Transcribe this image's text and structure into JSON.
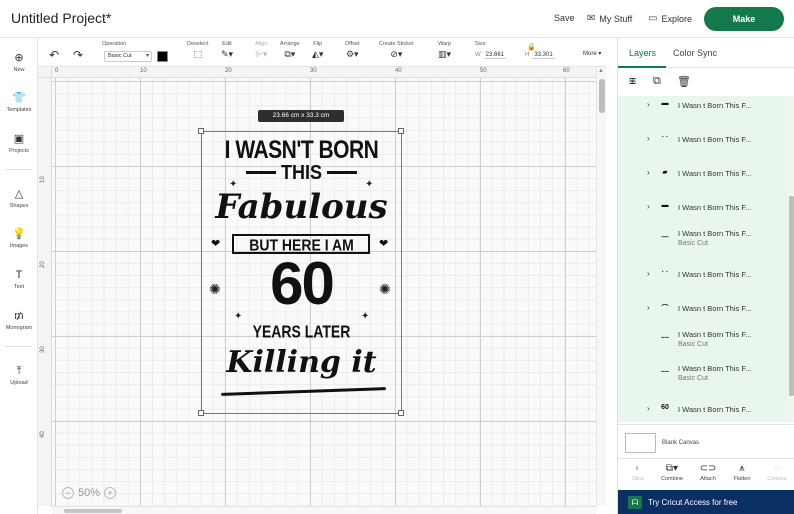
{
  "app": {
    "title": "Untitled Project*",
    "save_label": "Save",
    "mystuff_label": "My Stuff",
    "explore_label": "Explore",
    "make_label": "Make"
  },
  "sidebar": {
    "items": [
      {
        "label": "New",
        "icon": "plus-icon"
      },
      {
        "label": "Templates",
        "icon": "shirt-icon"
      },
      {
        "label": "Projects",
        "icon": "projects-icon"
      },
      {
        "label": "Shapes",
        "icon": "shapes-icon"
      },
      {
        "label": "Images",
        "icon": "lightbulb-icon"
      },
      {
        "label": "Text",
        "icon": "text-icon"
      },
      {
        "label": "Monogram",
        "icon": "monogram-icon"
      },
      {
        "label": "Upload",
        "icon": "upload-icon"
      }
    ]
  },
  "toolbar": {
    "operation_label": "Operation",
    "operation_value": "Basic Cut",
    "deselect_label": "Deselect",
    "edit_label": "Edit",
    "align_label": "Align",
    "arrange_label": "Arrange",
    "flip_label": "Flip",
    "offset_label": "Offset",
    "create_sticker_label": "Create Sticker",
    "warp_label": "Warp",
    "size_label": "Size",
    "width_key": "W",
    "width_value": "23.661",
    "height_key": "H",
    "height_value": "33.301",
    "more_label": "More"
  },
  "canvas": {
    "ruler_top": [
      "0",
      "10",
      "20",
      "30",
      "40",
      "50",
      "60"
    ],
    "ruler_left": [
      "10",
      "20",
      "30",
      "40"
    ],
    "size_tooltip": "23.66  cm x 33.3  cm",
    "zoom_level": "50%",
    "design_lines": [
      "I WASN'T BORN",
      "THIS",
      "Fabulous",
      "BUT HERE I AM",
      "60",
      "YEARS LATER",
      "Killing it"
    ]
  },
  "right_panel": {
    "tabs": [
      "Layers",
      "Color Sync"
    ],
    "layers": [
      {
        "name": "I Wasn t Born This F...",
        "sub": "",
        "thumb": "▬",
        "expandable": true
      },
      {
        "name": "I Wasn t Born This F...",
        "sub": "",
        "thumb": "· ·",
        "expandable": true
      },
      {
        "name": "I Wasn t Born This F...",
        "sub": "",
        "thumb": "▰",
        "expandable": true
      },
      {
        "name": "I Wasn t Born This F...",
        "sub": "",
        "thumb": "▬",
        "expandable": true
      },
      {
        "name": "I Wasn t Born This F...",
        "sub": "Basic Cut",
        "thumb": "—",
        "expandable": false
      },
      {
        "name": "I Wasn t Born This F...",
        "sub": "",
        "thumb": "· ·",
        "expandable": true
      },
      {
        "name": "I Wasn t Born This F...",
        "sub": "",
        "thumb": "⌒",
        "expandable": true
      },
      {
        "name": "I Wasn t Born This F...",
        "sub": "Basic Cut",
        "thumb": "~~",
        "expandable": false
      },
      {
        "name": "I Wasn t Born This F...",
        "sub": "Basic Cut",
        "thumb": "~~",
        "expandable": false
      },
      {
        "name": "I Wasn t Born This F...",
        "sub": "",
        "thumb": "60",
        "expandable": true
      }
    ],
    "blank_canvas_label": "Blank Canvas",
    "actions": [
      {
        "label": "Slice",
        "icon": "slice-icon",
        "enabled": false
      },
      {
        "label": "Combine",
        "icon": "combine-icon",
        "enabled": true
      },
      {
        "label": "Attach",
        "icon": "attach-icon",
        "enabled": true
      },
      {
        "label": "Flatten",
        "icon": "flatten-icon",
        "enabled": true
      },
      {
        "label": "Contour",
        "icon": "contour-icon",
        "enabled": false
      }
    ],
    "cta_label": "Try Cricut Access for free"
  }
}
